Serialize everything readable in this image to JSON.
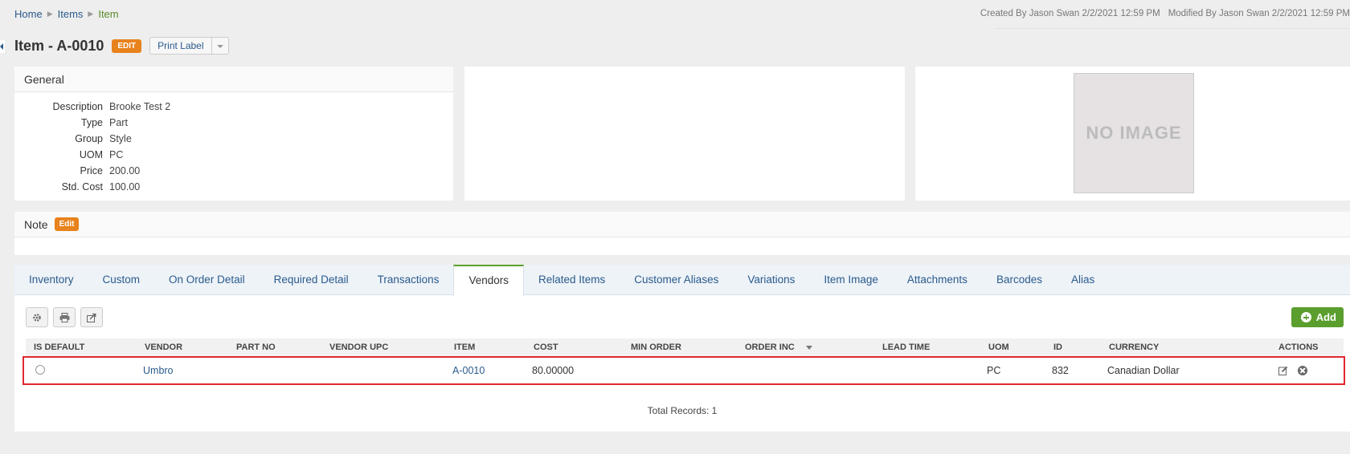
{
  "breadcrumb": {
    "home": "Home",
    "items": "Items",
    "current": "Item"
  },
  "meta": {
    "created": "Created By Jason Swan 2/2/2021 12:59 PM",
    "modified": "Modified By Jason Swan 2/2/2021 12:59 PM"
  },
  "header": {
    "title": "Item - A-0010",
    "edit_badge": "EDIT",
    "print_label": "Print Label"
  },
  "general": {
    "heading": "General",
    "fields": [
      {
        "label": "Description",
        "value": "Brooke Test 2"
      },
      {
        "label": "Type",
        "value": "Part"
      },
      {
        "label": "Group",
        "value": "Style"
      },
      {
        "label": "UOM",
        "value": "PC"
      },
      {
        "label": "Price",
        "value": "200.00"
      },
      {
        "label": "Std. Cost",
        "value": "100.00"
      }
    ]
  },
  "image": {
    "placeholder": "NO IMAGE"
  },
  "note": {
    "heading": "Note",
    "edit_badge": "Edit"
  },
  "tabs": [
    {
      "label": "Inventory",
      "active": false
    },
    {
      "label": "Custom",
      "active": false
    },
    {
      "label": "On Order Detail",
      "active": false
    },
    {
      "label": "Required Detail",
      "active": false
    },
    {
      "label": "Transactions",
      "active": false
    },
    {
      "label": "Vendors",
      "active": true
    },
    {
      "label": "Related Items",
      "active": false
    },
    {
      "label": "Customer Aliases",
      "active": false
    },
    {
      "label": "Variations",
      "active": false
    },
    {
      "label": "Item Image",
      "active": false
    },
    {
      "label": "Attachments",
      "active": false
    },
    {
      "label": "Barcodes",
      "active": false
    },
    {
      "label": "Alias",
      "active": false
    }
  ],
  "toolbar": {
    "add_label": "Add",
    "icons": [
      "gear-icon",
      "print-icon",
      "export-icon"
    ]
  },
  "grid": {
    "columns": [
      "IS DEFAULT",
      "VENDOR",
      "PART NO",
      "VENDOR UPC",
      "ITEM",
      "COST",
      "MIN ORDER",
      "ORDER INC",
      "LEAD TIME",
      "UOM",
      "ID",
      "CURRENCY",
      "ACTIONS"
    ],
    "sorted_column": "ORDER INC",
    "rows": [
      {
        "is_default": false,
        "vendor": "Umbro",
        "part_no": "",
        "vendor_upc": "",
        "item": "A-0010",
        "cost": "80.00000",
        "min_order": "",
        "order_inc": "",
        "lead_time": "",
        "uom": "PC",
        "id": "832",
        "currency": "Canadian Dollar"
      }
    ],
    "total": "Total Records: 1"
  },
  "colors": {
    "accent_green": "#5a9e2e",
    "edit_orange": "#e8821c",
    "highlight_red": "#e0282f",
    "link_blue": "#2a5a8c"
  }
}
